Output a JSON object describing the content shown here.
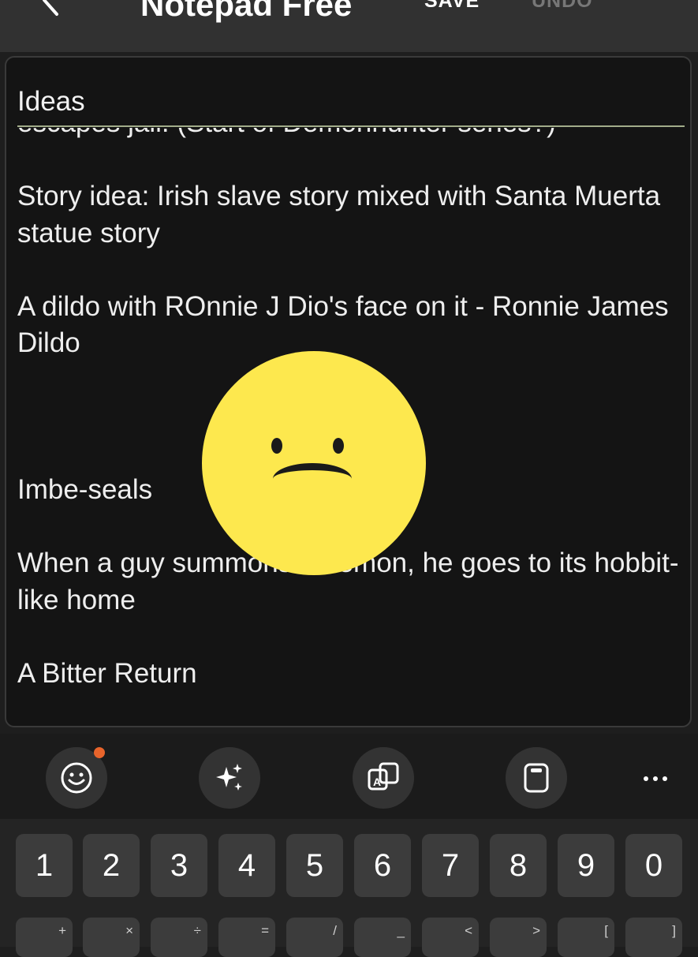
{
  "appbar": {
    "title": "Notepad Free",
    "save_label": "SAVE",
    "undo_label": "UNDO"
  },
  "note": {
    "title": "Ideas",
    "paragraphs": [
      "escapes jail. (Start of Demonhunter series?)",
      "Story idea: Irish slave story mixed with Santa Muerta statue story",
      "A dildo with ROnnie J Dio's face on it - Ronnie James Dildo",
      "Imbe-seals",
      "When a guy summons a demon, he goes to its hobbit-like home",
      "A Bitter Return"
    ]
  },
  "sticker": {
    "icon": "sad-face-emoji",
    "color": "#fde84e"
  },
  "keyboard_toolbar": {
    "items": [
      "emoji-icon",
      "ai-sparkle-icon",
      "translate-icon",
      "clipboard-icon",
      "more-icon"
    ],
    "notification_color": "#e8642b"
  },
  "keyboard": {
    "number_row": [
      "1",
      "2",
      "3",
      "4",
      "5",
      "6",
      "7",
      "8",
      "9",
      "0"
    ],
    "second_row_symbols": [
      "+",
      "×",
      "÷",
      "=",
      "/",
      "_",
      "<",
      ">",
      "[",
      "]"
    ]
  },
  "colors": {
    "background": "#141414",
    "appbar": "#313131",
    "title_underline": "#a2ad8a"
  }
}
